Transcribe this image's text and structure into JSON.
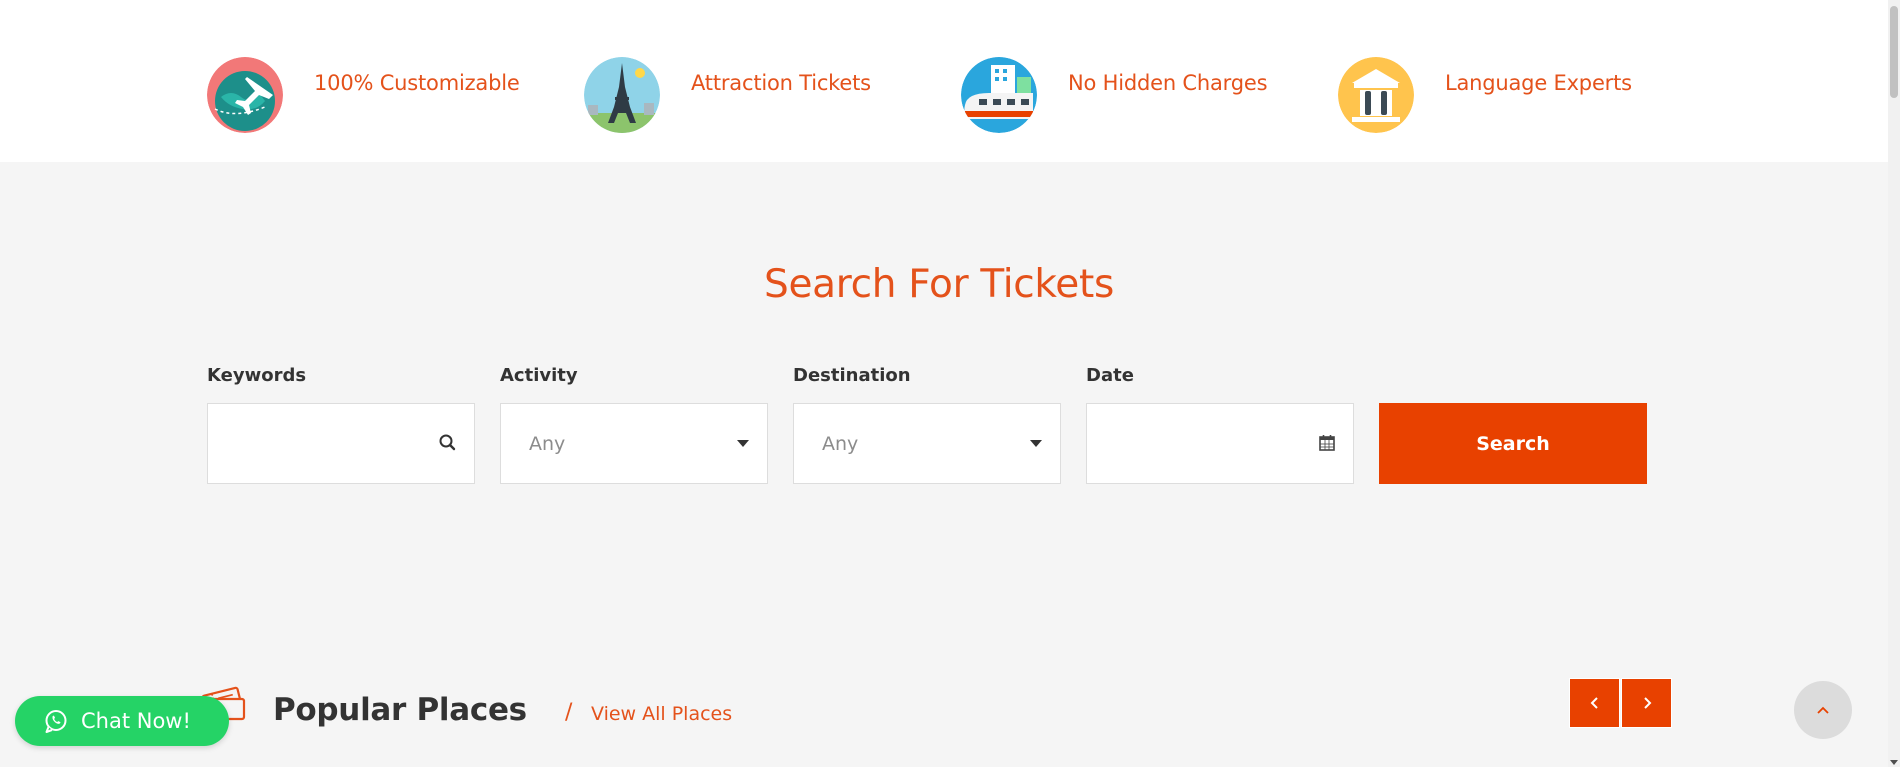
{
  "features": [
    {
      "label": "100% Customizable",
      "icon": "globe-plane-icon"
    },
    {
      "label": "Attraction Tickets",
      "icon": "eiffel-tower-icon"
    },
    {
      "label": "No Hidden Charges",
      "icon": "train-city-icon"
    },
    {
      "label": "Language Experts",
      "icon": "museum-columns-icon"
    }
  ],
  "search": {
    "title": "Search For Tickets",
    "keywords_label": "Keywords",
    "keywords_value": "",
    "activity_label": "Activity",
    "activity_value": "Any",
    "destination_label": "Destination",
    "destination_value": "Any",
    "date_label": "Date",
    "date_value": "",
    "button_label": "Search"
  },
  "popular": {
    "title": "Popular Places",
    "separator": "/",
    "link_label": "View All Places",
    "icon": "tickets-icon"
  },
  "chat": {
    "label": "Chat Now!"
  },
  "colors": {
    "accent": "#e4521b",
    "button": "#e84100",
    "chat": "#25d366"
  }
}
